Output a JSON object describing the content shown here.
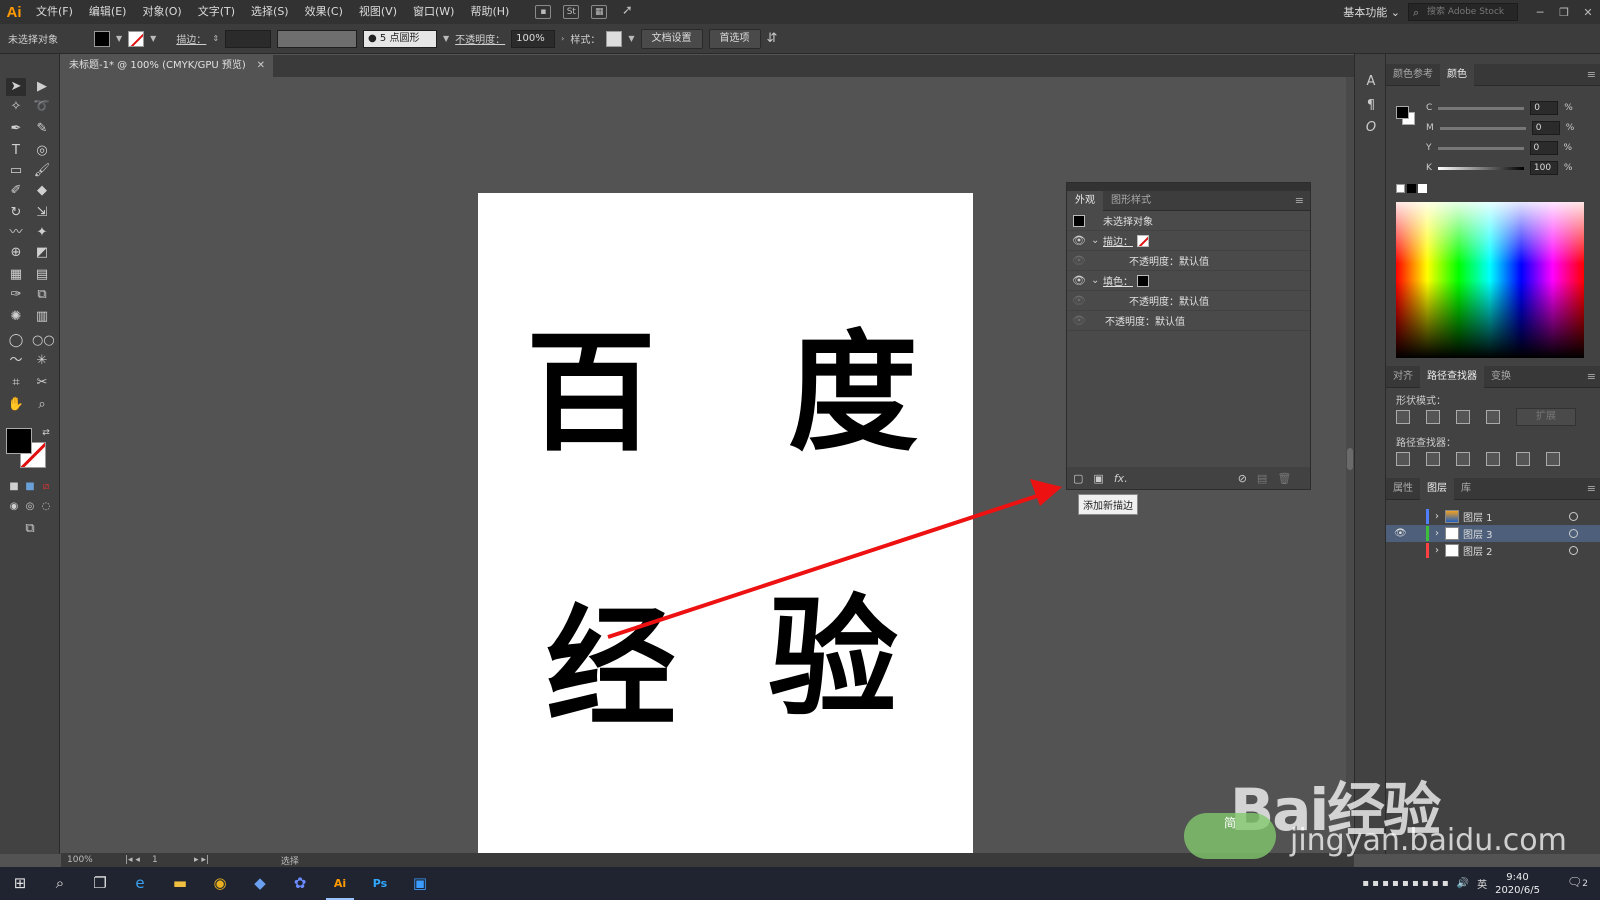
{
  "app": {
    "logo": "Ai"
  },
  "menu": [
    "文件(F)",
    "编辑(E)",
    "对象(O)",
    "文字(T)",
    "选择(S)",
    "效果(C)",
    "视图(V)",
    "窗口(W)",
    "帮助(H)"
  ],
  "menu_right": {
    "workspace": "基本功能",
    "stock_placeholder": "搜索 Adobe Stock"
  },
  "control": {
    "selection": "未选择对象",
    "stroke_label": "描边：",
    "brush": "● 5 点圆形",
    "opacity_label": "不透明度：",
    "opacity_value": "100%",
    "style_label": "样式：",
    "doc_settings": "文档设置",
    "preferences": "首选项"
  },
  "document": {
    "tab_title": "未标题-1* @ 100% (CMYK/GPU 预览)"
  },
  "artboard": {
    "chars": [
      "百",
      "度",
      "经",
      "验"
    ]
  },
  "status": {
    "zoom": "100%",
    "page": "1",
    "tool": "选择"
  },
  "appearance_panel": {
    "tabs": [
      "外观",
      "图形样式"
    ],
    "header": "未选择对象",
    "rows": [
      {
        "label": "描边：",
        "type": "stroke"
      },
      {
        "label": "不透明度：默认值",
        "type": "sub"
      },
      {
        "label": "填色：",
        "type": "fill"
      },
      {
        "label": "不透明度：默认值",
        "type": "sub"
      },
      {
        "label": "不透明度：默认值",
        "type": "top"
      }
    ],
    "tooltip": "添加新描边"
  },
  "color_panel": {
    "tabs": [
      "颜色参考",
      "颜色"
    ],
    "channels": [
      {
        "name": "C",
        "value": "0"
      },
      {
        "name": "M",
        "value": "0"
      },
      {
        "name": "Y",
        "value": "0"
      },
      {
        "name": "K",
        "value": "100"
      }
    ],
    "unit": "%"
  },
  "pathfinder_panel": {
    "tabs": [
      "对齐",
      "路径查找器",
      "变换"
    ],
    "shape_modes_label": "形状模式：",
    "expand_label": "扩展",
    "pathfinders_label": "路径查找器："
  },
  "layers_panel": {
    "tabs": [
      "属性",
      "图层",
      "库"
    ],
    "layers": [
      {
        "name": "图层 1",
        "color": "#4f7fff"
      },
      {
        "name": "图层 3",
        "color": "#3cbf3c"
      },
      {
        "name": "图层 2",
        "color": "#ff4040"
      }
    ]
  },
  "taskbar": {
    "time": "9:40",
    "date": "2020/6/5",
    "ime": "英",
    "notifications": "2"
  },
  "watermark": {
    "brand": "Bai经验",
    "url": "jingyan.baidu.com",
    "badge": "简"
  }
}
